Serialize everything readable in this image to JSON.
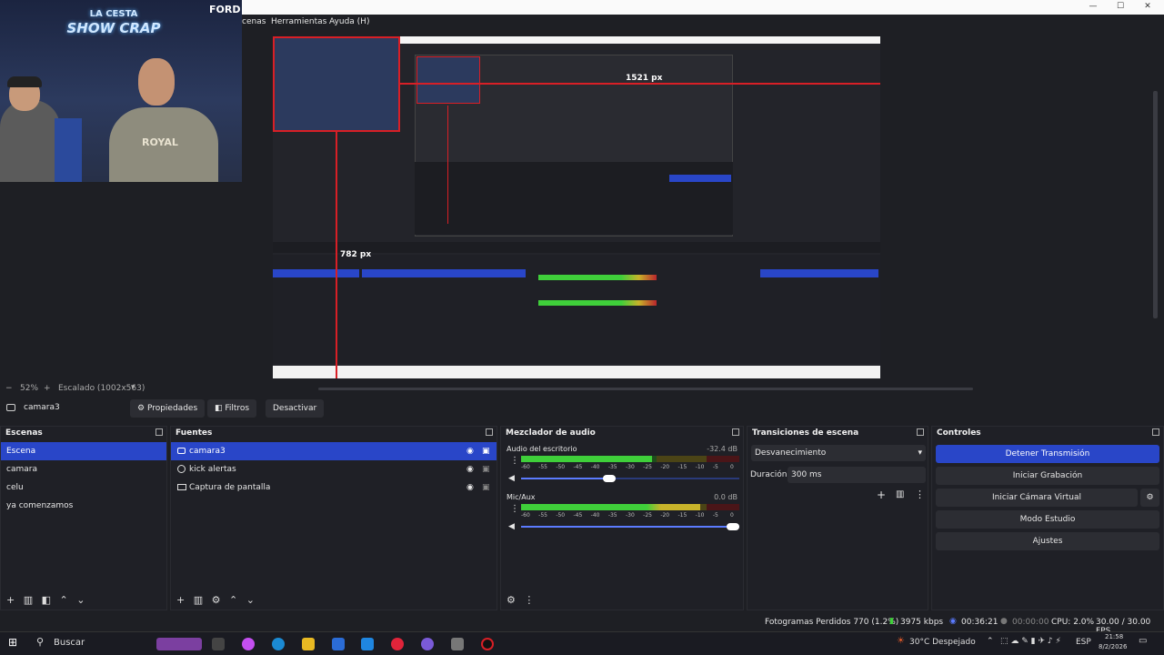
{
  "camera_overlay": {
    "ford_label": "FORD",
    "neon_line1": "LA CESTA",
    "neon_line2": "SHOW CRAP",
    "shirt_text": "ROYAL"
  },
  "window": {
    "menu_items": [
      "cenas",
      "Herramientas",
      "Ayuda (H)"
    ],
    "minimize": "—",
    "maximize": "☐",
    "close": "✕"
  },
  "preview": {
    "width_label": "1521 px",
    "height_label": "782 px"
  },
  "canvas_status": {
    "zoom": "52%",
    "scale_label": "Escalado (1002x563)"
  },
  "source_toolbar": {
    "source_name": "camara3",
    "properties_label": "Propiedades",
    "filters_label": "Filtros",
    "deactivate_label": "Desactivar"
  },
  "scenes": {
    "title": "Escenas",
    "items": [
      "Escena",
      "camara",
      "celu",
      "ya comenzamos"
    ],
    "selected": 0
  },
  "sources": {
    "title": "Fuentes",
    "items": [
      {
        "name": "camara3",
        "icon": "camera-icon"
      },
      {
        "name": "kick alertas",
        "icon": "browser-icon"
      },
      {
        "name": "Captura de pantalla",
        "icon": "monitor-icon"
      }
    ],
    "selected": 0
  },
  "mixer": {
    "title": "Mezclador de audio",
    "scale": [
      "-60",
      "-55",
      "-50",
      "-45",
      "-40",
      "-35",
      "-30",
      "-25",
      "-20",
      "-15",
      "-10",
      "-5",
      "0"
    ],
    "channels": [
      {
        "name": "Audio del escritorio",
        "db": "-32.4 dB",
        "level": 0.6,
        "volume": 0.4
      },
      {
        "name": "Mic/Aux",
        "db": "0.0 dB",
        "level": 0.82,
        "volume": 1.0
      }
    ]
  },
  "transitions": {
    "title": "Transiciones de escena",
    "selected": "Desvanecimiento",
    "duration_label": "Duración",
    "duration_value": "300 ms"
  },
  "controls": {
    "title": "Controles",
    "buttons": [
      "Detener Transmisión",
      "Iniciar Grabación",
      "Iniciar Cámara Virtual",
      "Modo Estudio",
      "Ajustes"
    ]
  },
  "status": {
    "dropped": "Fotogramas Perdidos 770 (1.2%)",
    "bitrate": "3975 kbps",
    "live_time": "00:36:21",
    "rec_time": "00:00:00",
    "cpu": "CPU: 2.0%",
    "fps": "30.00 / 30.00 FPS"
  },
  "taskbar": {
    "search": "Buscar",
    "weather": "30°C  Despejado",
    "lang": "ESP",
    "time": "21:58",
    "date": "8/2/2026"
  },
  "colors": {
    "accent": "#2946c8",
    "recording_red": "#d81f26",
    "meter_green": "#3fcf3a",
    "meter_yellow": "#c8b32a",
    "meter_red": "#b9252c"
  }
}
